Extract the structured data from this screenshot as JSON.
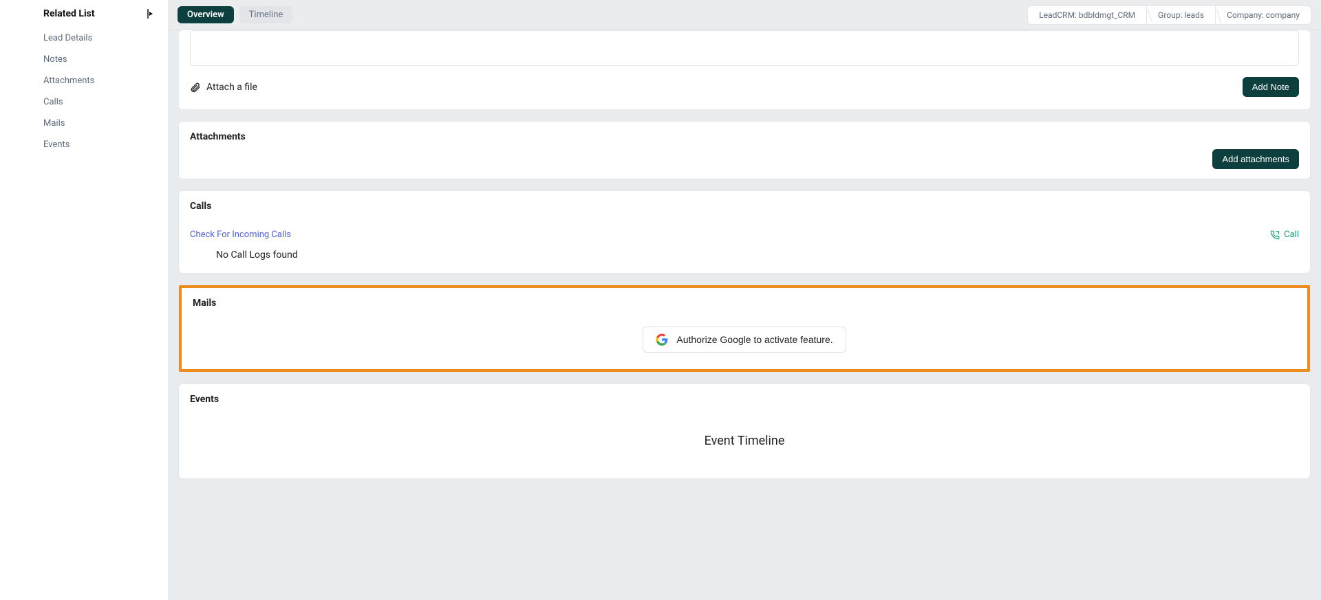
{
  "sidebar": {
    "title": "Related List",
    "items": [
      {
        "label": "Lead Details"
      },
      {
        "label": "Notes"
      },
      {
        "label": "Attachments"
      },
      {
        "label": "Calls"
      },
      {
        "label": "Mails"
      },
      {
        "label": "Events"
      }
    ]
  },
  "topbar": {
    "tabs": [
      {
        "label": "Overview",
        "active": true
      },
      {
        "label": "Timeline",
        "active": false
      }
    ],
    "breadcrumbs": [
      {
        "label": "LeadCRM: bdbldmgt_CRM"
      },
      {
        "label": "Group: leads"
      },
      {
        "label": "Company: company"
      }
    ]
  },
  "notes": {
    "attach_label": "Attach a file",
    "add_button": "Add Note"
  },
  "attachments": {
    "title": "Attachments",
    "add_button": "Add attachments"
  },
  "calls": {
    "title": "Calls",
    "check_link": "Check For Incoming Calls",
    "call_link": "Call",
    "empty": "No Call Logs found"
  },
  "mails": {
    "title": "Mails",
    "authorize_label": "Authorize Google to activate feature."
  },
  "events": {
    "title": "Events",
    "body": "Event Timeline"
  }
}
